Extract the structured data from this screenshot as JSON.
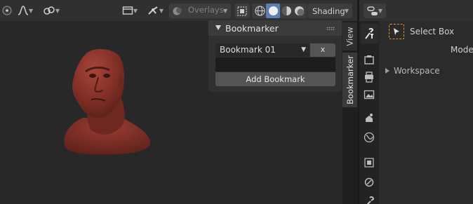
{
  "header": {
    "overlays_label": "Overlays",
    "shading_label": "Shading"
  },
  "panel": {
    "title": "Bookmarker",
    "selected_bookmark": "Bookmark 01",
    "remove_label": "x",
    "name_value": "",
    "add_label": "Add Bookmark"
  },
  "sidebar_tabs": {
    "view": "View",
    "bookmarker": "Bookmarker"
  },
  "properties": {
    "select_box_label": "Select Box",
    "mode_label": "Mode",
    "workspace_label": "Workspace"
  },
  "colors": {
    "accent_orange": "#e28f2e",
    "model_skin": "#8a3327"
  }
}
